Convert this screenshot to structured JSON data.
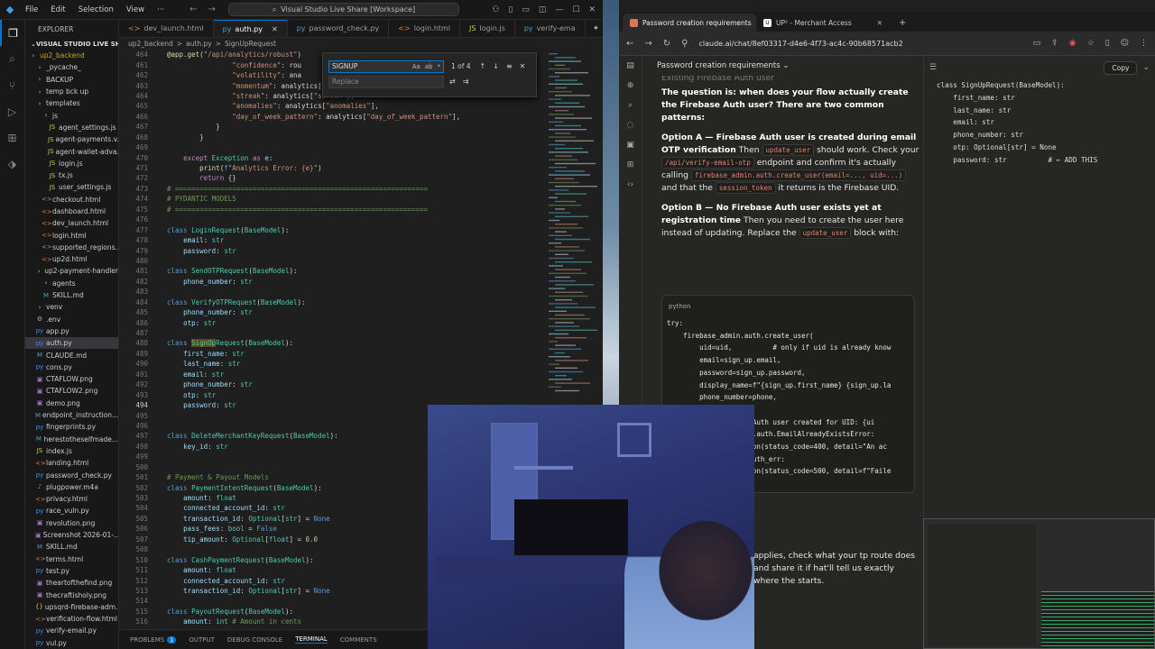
{
  "vscode": {
    "menu": [
      "File",
      "Edit",
      "Selection",
      "View"
    ],
    "search_text": "Visual Studio Live Share [Workspace]",
    "explorer_label": "EXPLORER",
    "workspace": "VISUAL STUDIO LIVE SHA...",
    "tree": [
      {
        "label": "up2_backend",
        "type": "folder",
        "indent": 0,
        "color": "#cca700"
      },
      {
        "label": "_pycache_",
        "type": "folder",
        "indent": 1
      },
      {
        "label": "BACKUP",
        "type": "folder",
        "indent": 1
      },
      {
        "label": "temp bck up",
        "type": "folder",
        "indent": 1
      },
      {
        "label": "templates",
        "type": "folder",
        "indent": 1
      },
      {
        "label": "js",
        "type": "folder",
        "indent": 2
      },
      {
        "label": "agent_settings.js",
        "type": "js",
        "indent": 3
      },
      {
        "label": "agent-payments.v...",
        "type": "js",
        "indent": 3
      },
      {
        "label": "agent-wallet-adva...",
        "type": "js",
        "indent": 3
      },
      {
        "label": "login.js",
        "type": "js",
        "indent": 3
      },
      {
        "label": "tx.js",
        "type": "js",
        "indent": 3
      },
      {
        "label": "user_settings.js",
        "type": "js",
        "indent": 3
      },
      {
        "label": "checkout.html",
        "type": "html",
        "indent": 2
      },
      {
        "label": "dashboard.html",
        "type": "html",
        "indent": 2
      },
      {
        "label": "dev_launch.html",
        "type": "html",
        "indent": 2
      },
      {
        "label": "login.html",
        "type": "html",
        "indent": 2
      },
      {
        "label": "supported_regions...",
        "type": "html",
        "indent": 2
      },
      {
        "label": "up2d.html",
        "type": "html",
        "indent": 2
      },
      {
        "label": "up2-payment-handler",
        "type": "folder",
        "indent": 1
      },
      {
        "label": "agents",
        "type": "folder",
        "indent": 2
      },
      {
        "label": "SKILL.md",
        "type": "md",
        "indent": 2
      },
      {
        "label": "venv",
        "type": "folder",
        "indent": 1
      },
      {
        "label": ".env",
        "type": "env",
        "indent": 1
      },
      {
        "label": "app.py",
        "type": "py",
        "indent": 1
      },
      {
        "label": "auth.py",
        "type": "py",
        "indent": 1,
        "selected": true
      },
      {
        "label": "CLAUDE.md",
        "type": "md",
        "indent": 1
      },
      {
        "label": "cons.py",
        "type": "py",
        "indent": 1
      },
      {
        "label": "CTAFLOW.png",
        "type": "img",
        "indent": 1
      },
      {
        "label": "CTAFLOW2.png",
        "type": "img",
        "indent": 1
      },
      {
        "label": "demo.png",
        "type": "img",
        "indent": 1
      },
      {
        "label": "endpoint_instruction...",
        "type": "md",
        "indent": 1
      },
      {
        "label": "fingerprints.py",
        "type": "py",
        "indent": 1
      },
      {
        "label": "herestotheselfmade...",
        "type": "md",
        "indent": 1
      },
      {
        "label": "index.js",
        "type": "js",
        "indent": 1
      },
      {
        "label": "landing.html",
        "type": "html",
        "indent": 1
      },
      {
        "label": "password_check.py",
        "type": "py",
        "indent": 1
      },
      {
        "label": "plugpower.m4a",
        "type": "audio",
        "indent": 1
      },
      {
        "label": "privacy.html",
        "type": "html",
        "indent": 1
      },
      {
        "label": "race_vuln.py",
        "type": "py",
        "indent": 1
      },
      {
        "label": "revolution.png",
        "type": "img",
        "indent": 1
      },
      {
        "label": "Screenshot 2026-01-...",
        "type": "img",
        "indent": 1
      },
      {
        "label": "SKILL.md",
        "type": "md",
        "indent": 1
      },
      {
        "label": "terms.html",
        "type": "html",
        "indent": 1
      },
      {
        "label": "test.py",
        "type": "py",
        "indent": 1
      },
      {
        "label": "theartofthefind.png",
        "type": "img",
        "indent": 1
      },
      {
        "label": "thecraftisholy.png",
        "type": "img",
        "indent": 1
      },
      {
        "label": "upsqrd-firebase-adm...",
        "type": "json",
        "indent": 1
      },
      {
        "label": "verification-flow.html",
        "type": "html",
        "indent": 1
      },
      {
        "label": "verify-email.py",
        "type": "py",
        "indent": 1
      },
      {
        "label": "vul.py",
        "type": "py",
        "indent": 1
      }
    ],
    "tabs": [
      {
        "label": "dev_launch.html",
        "icon": "<>",
        "active": false
      },
      {
        "label": "auth.py",
        "icon": "py",
        "active": true
      },
      {
        "label": "password_check.py",
        "icon": "py",
        "active": false
      },
      {
        "label": "login.html",
        "icon": "<>",
        "active": false
      },
      {
        "label": "login.js",
        "icon": "JS",
        "active": false
      },
      {
        "label": "verify-ema",
        "icon": "py",
        "active": false
      }
    ],
    "breadcrumb": [
      "up2_backend",
      ">",
      "auth.py",
      ">",
      "SignUpRequest"
    ],
    "find": {
      "value": "SIGNUP",
      "count": "1 of 4",
      "replace_placeholder": "Replace",
      "opts": [
        "Aa",
        "ab",
        "*"
      ]
    },
    "code": [
      {
        "n": "464",
        "h": "<span class='fn'>@app.get</span>(<span class='str'>\"/api/analytics/robust\"</span>)"
      },
      {
        "n": "461",
        "h": "                <span class='str'>\"confidence\"</span>: rou"
      },
      {
        "n": "462",
        "h": "                <span class='str'>\"volatility\"</span>: ana"
      },
      {
        "n": "463",
        "h": "                <span class='str'>\"momentum\"</span>: analytics[<span class='str'>\"momentum\"</span>],"
      },
      {
        "n": "464",
        "h": "                <span class='str'>\"streak\"</span>: analytics[<span class='str'>\"streak\"</span>],"
      },
      {
        "n": "465",
        "h": "                <span class='str'>\"anomalies\"</span>: analytics[<span class='str'>\"anomalies\"</span>],"
      },
      {
        "n": "466",
        "h": "                <span class='str'>\"day_of_week_pattern\"</span>: analytics[<span class='str'>\"day_of_week_pattern\"</span>],"
      },
      {
        "n": "467",
        "h": "            }"
      },
      {
        "n": "468",
        "h": "        }"
      },
      {
        "n": "469",
        "h": ""
      },
      {
        "n": "470",
        "h": "    <span class='kw2'>except</span> <span class='cls'>Exception</span> <span class='kw2'>as</span> <span class='var'>e</span>:"
      },
      {
        "n": "471",
        "h": "        <span class='fn'>print</span>(<span class='kw'>f</span><span class='str'>\"Analytics Error: {e}\"</span>)"
      },
      {
        "n": "472",
        "h": "        <span class='kw2'>return</span> {}"
      },
      {
        "n": "473",
        "h": "<span class='cm'># ==============================================================</span>"
      },
      {
        "n": "474",
        "h": "<span class='cm'># PYDANTIC MODELS</span>"
      },
      {
        "n": "475",
        "h": "<span class='cm'># ==============================================================</span>"
      },
      {
        "n": "476",
        "h": ""
      },
      {
        "n": "477",
        "h": "<span class='kw'>class</span> <span class='cls'>LoginRequest</span>(<span class='cls'>BaseModel</span>):"
      },
      {
        "n": "478",
        "h": "    <span class='var'>email</span>: <span class='cls'>str</span>"
      },
      {
        "n": "479",
        "h": "    <span class='var'>password</span>: <span class='cls'>str</span>"
      },
      {
        "n": "480",
        "h": ""
      },
      {
        "n": "481",
        "h": "<span class='kw'>class</span> <span class='cls'>SendOTPRequest</span>(<span class='cls'>BaseModel</span>):"
      },
      {
        "n": "482",
        "h": "    <span class='var'>phone_number</span>: <span class='cls'>str</span>"
      },
      {
        "n": "483",
        "h": ""
      },
      {
        "n": "484",
        "h": "<span class='kw'>class</span> <span class='cls'>VerifyOTPRequest</span>(<span class='cls'>BaseModel</span>):"
      },
      {
        "n": "485",
        "h": "    <span class='var'>phone_number</span>: <span class='cls'>str</span>"
      },
      {
        "n": "486",
        "h": "    <span class='var'>otp</span>: <span class='cls'>str</span>"
      },
      {
        "n": "487",
        "h": ""
      },
      {
        "n": "488",
        "h": "<span class='kw'>class</span> <span class='cls'><span style='background:#5a4a1a'>SignUp</span>Request</span>(<span class='cls'>BaseModel</span>):"
      },
      {
        "n": "489",
        "h": "    <span class='var'>first_name</span>: <span class='cls'>str</span>"
      },
      {
        "n": "490",
        "h": "    <span class='var'>last_name</span>: <span class='cls'>str</span>"
      },
      {
        "n": "491",
        "h": "    <span class='var'>email</span>: <span class='cls'>str</span>"
      },
      {
        "n": "492",
        "h": "    <span class='var'>phone_number</span>: <span class='cls'>str</span>"
      },
      {
        "n": "493",
        "h": "    <span class='var'>otp</span>: <span class='cls'>str</span>"
      },
      {
        "n": "494",
        "h": "    <span class='var'>password</span>: <span class='cls'>str</span>",
        "cur": true
      },
      {
        "n": "495",
        "h": ""
      },
      {
        "n": "496",
        "h": ""
      },
      {
        "n": "497",
        "h": "<span class='kw'>class</span> <span class='cls'>DeleteMerchantKeyRequest</span>(<span class='cls'>BaseModel</span>):"
      },
      {
        "n": "498",
        "h": "    <span class='var'>key_id</span>: <span class='cls'>str</span>"
      },
      {
        "n": "499",
        "h": ""
      },
      {
        "n": "500",
        "h": ""
      },
      {
        "n": "501",
        "h": "<span class='cm'># Payment & Payout Models</span>"
      },
      {
        "n": "502",
        "h": "<span class='kw'>class</span> <span class='cls'>PaymentIntentRequest</span>(<span class='cls'>BaseModel</span>):"
      },
      {
        "n": "503",
        "h": "    <span class='var'>amount</span>: <span class='cls'>float</span>"
      },
      {
        "n": "504",
        "h": "    <span class='var'>connected_account_id</span>: <span class='cls'>str</span>"
      },
      {
        "n": "505",
        "h": "    <span class='var'>transaction_id</span>: <span class='cls'>Optional</span>[<span class='cls'>str</span>] = <span class='kw'>None</span>"
      },
      {
        "n": "506",
        "h": "    <span class='var'>pass_fees</span>: <span class='cls'>bool</span> = <span class='kw'>False</span>"
      },
      {
        "n": "507",
        "h": "    <span class='var'>tip_amount</span>: <span class='cls'>Optional</span>[<span class='cls'>float</span>] = <span class='num2'>0.0</span>"
      },
      {
        "n": "508",
        "h": ""
      },
      {
        "n": "510",
        "h": "<span class='kw'>class</span> <span class='cls'>CashPaymentRequest</span>(<span class='cls'>BaseModel</span>):"
      },
      {
        "n": "511",
        "h": "    <span class='var'>amount</span>: <span class='cls'>float</span>"
      },
      {
        "n": "512",
        "h": "    <span class='var'>connected_account_id</span>: <span class='cls'>str</span>"
      },
      {
        "n": "513",
        "h": "    <span class='var'>transaction_id</span>: <span class='cls'>Optional</span>[<span class='cls'>str</span>] = <span class='kw'>None</span>"
      },
      {
        "n": "514",
        "h": ""
      },
      {
        "n": "515",
        "h": "<span class='kw'>class</span> <span class='cls'>PayoutRequest</span>(<span class='cls'>BaseModel</span>):"
      },
      {
        "n": "516",
        "h": "    <span class='var'>amount</span>: <span class='cls'>int</span> <span class='cm'># Amount in cents</span>"
      }
    ],
    "panel_tabs": [
      {
        "label": "PROBLEMS",
        "badge": "1"
      },
      {
        "label": "OUTPUT"
      },
      {
        "label": "DEBUG CONSOLE"
      },
      {
        "label": "TERMINAL",
        "active": true
      },
      {
        "label": "COMMENTS"
      }
    ]
  },
  "browser": {
    "tabs": [
      {
        "label": "Password creation requirements",
        "active": true
      },
      {
        "label": "UP² - Merchant Access",
        "active": false
      }
    ],
    "url": "claude.ai/chat/8ef03317-d4e6-4f73-ac4c-90b68571acb2",
    "chat_title": "Password creation requirements",
    "copy_label": "Copy",
    "faded_heading": "Existing Firebase Auth user",
    "p1": "The question is: when does your flow actually create the Firebase Auth user? There are two common patterns:",
    "optA_title": "Option A — Firebase Auth user is created during email OTP verification",
    "optA_a": " Then ",
    "optA_code1": "update_user",
    "optA_b": " should work. Check your ",
    "optA_code2": "/api/verify-email-otp",
    "optA_c": " endpoint and confirm it's actually calling ",
    "optA_code3": "firebase_admin.auth.create_user(email=..., uid=...)",
    "optA_d": " and that the ",
    "optA_code4": "session_token",
    "optA_e": " it returns is the Firebase UID.",
    "optB_title": "Option B — No Firebase Auth user exists yet at registration time",
    "optB_a": " Then you need to create the user here instead of updating. Replace the ",
    "optB_code": "update_user",
    "optB_b": " block with:",
    "code_lang": "python",
    "code": "try:\n    firebase_admin.auth.create_user(\n        uid=uid,          # only if uid is already know\n        email=sign_up.email,\n        password=sign_up.password,\n        display_name=f\"{sign_up.first_name} {sign_up.la\n        phone_number=phone,\n    )\n    print(f\"Firebase Auth user created for UID: {ui\nexcept firebase_admin.auth.EmailAlreadyExistsError:\n    raise HTTPException(status_code=400, detail=\"An ac\nexcept Exception as auth_err:\n    raise HTTPException(status_code=500, detail=f\"Faile",
    "after": "applies, check what your tp route does and share it if hat'll tell us exactly where the starts.",
    "artifact_code": "class SignUpRequest(BaseModel):\n    first_name: str\n    last_name: str\n    email: str\n    phone_number: str\n    otp: Optional[str] = None\n    password: str          # ← ADD THIS"
  }
}
